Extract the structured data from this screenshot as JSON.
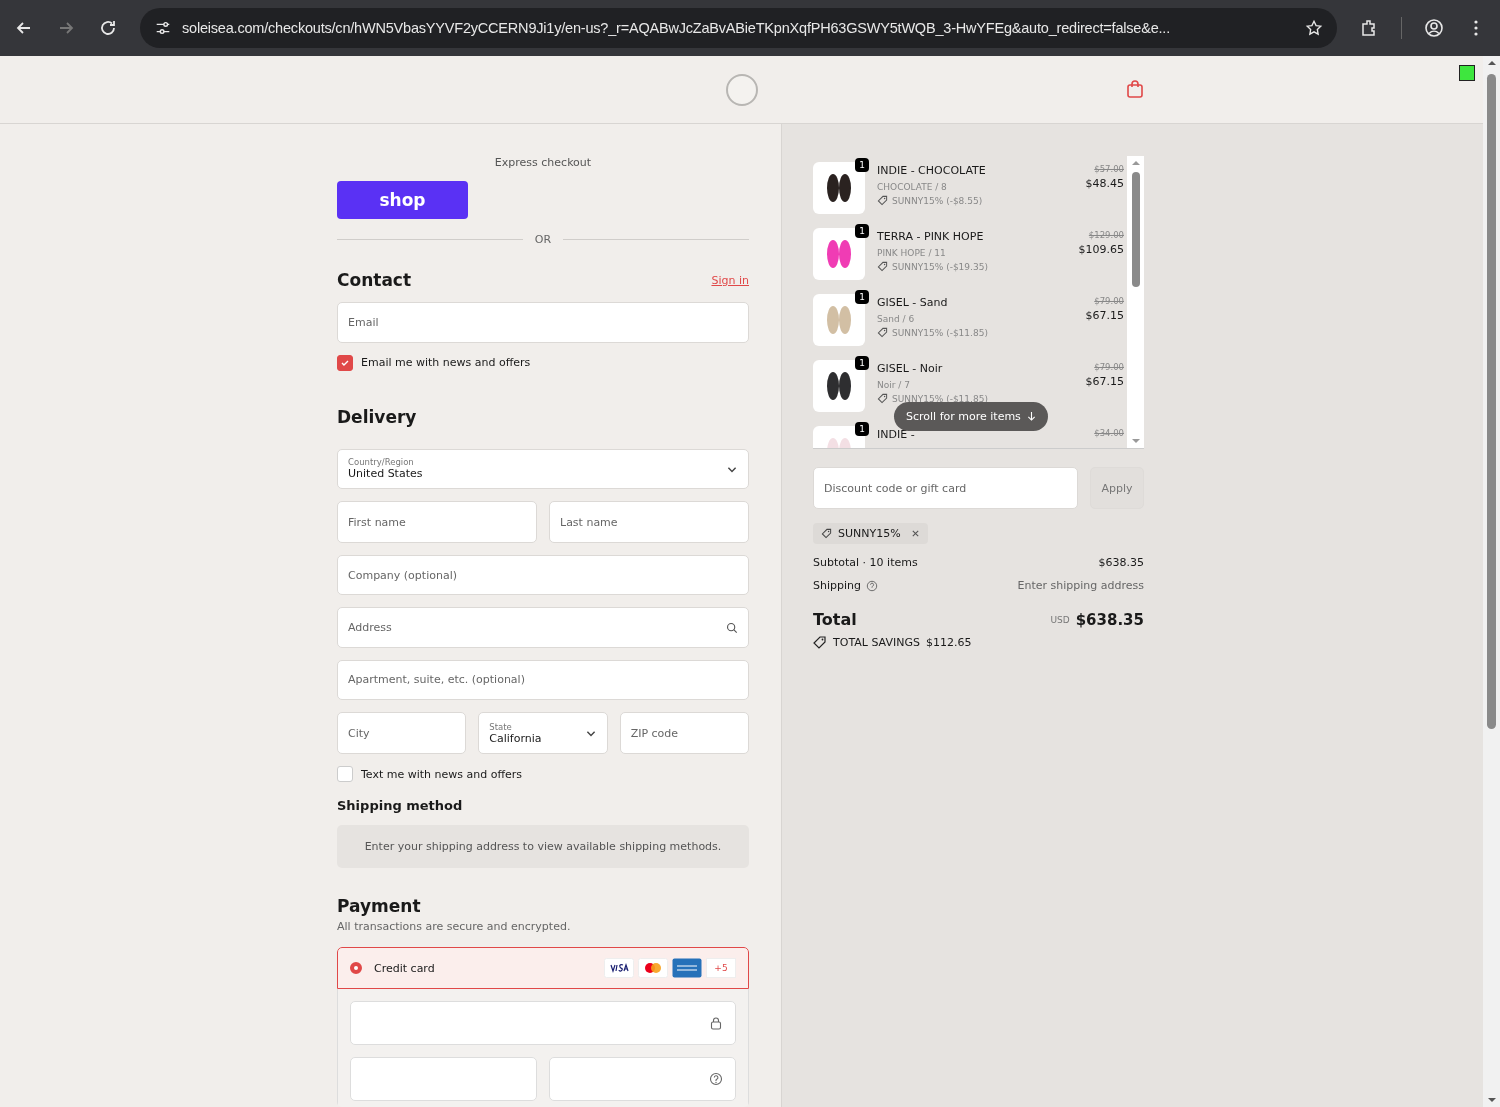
{
  "browser": {
    "url": "soleisea.com/checkouts/cn/hWN5VbasYYVF2yCCERN9Ji1y/en-us?_r=AQABwJcZaBvABieTKpnXqfPH63GSWY5tWQB_3-HwYFEg&auto_redirect=false&e..."
  },
  "express": {
    "title": "Express checkout",
    "shop_button": "shop",
    "divider": "OR"
  },
  "contact": {
    "heading": "Contact",
    "sign_in": "Sign in",
    "email_placeholder": "Email",
    "newsletter": {
      "label": "Email me with news and offers",
      "checked": true
    }
  },
  "delivery": {
    "heading": "Delivery",
    "country": {
      "label": "Country/Region",
      "value": "United States"
    },
    "first_name_placeholder": "First name",
    "last_name_placeholder": "Last name",
    "company_placeholder": "Company (optional)",
    "address_placeholder": "Address",
    "apartment_placeholder": "Apartment, suite, etc. (optional)",
    "city_placeholder": "City",
    "state": {
      "label": "State",
      "value": "California"
    },
    "zip_placeholder": "ZIP code",
    "sms": {
      "label": "Text me with news and offers",
      "checked": false
    }
  },
  "shipping_method": {
    "heading": "Shipping method",
    "notice": "Enter your shipping address to view available shipping methods."
  },
  "payment": {
    "heading": "Payment",
    "subtitle": "All transactions are secure and encrypted.",
    "methods": [
      {
        "label": "Credit card",
        "selected": true,
        "more": "+5"
      }
    ]
  },
  "cart": {
    "items": [
      {
        "name": "INDIE - CHOCOLATE",
        "variant": "CHOCOLATE / 8",
        "discount": "SUNNY15% (-$8.55)",
        "quantity": "1",
        "old_price": "$57.00",
        "price": "$48.45",
        "color": "#2a2220"
      },
      {
        "name": "TERRA - PINK HOPE",
        "variant": "PINK HOPE / 11",
        "discount": "SUNNY15% (-$19.35)",
        "quantity": "1",
        "old_price": "$129.00",
        "price": "$109.65",
        "color": "#f03cb4"
      },
      {
        "name": "GISEL - Sand",
        "variant": "Sand / 6",
        "discount": "SUNNY15% (-$11.85)",
        "quantity": "1",
        "old_price": "$79.00",
        "price": "$67.15",
        "color": "#d2bfa4"
      },
      {
        "name": "GISEL - Noir",
        "variant": "Noir / 7",
        "discount": "SUNNY15% (-$11.85)",
        "quantity": "1",
        "old_price": "$79.00",
        "price": "$67.15",
        "color": "#2e2e30"
      },
      {
        "name": "INDIE -",
        "quantity": "1",
        "old_price": "$34.00",
        "color": "#f3dfe4"
      }
    ],
    "scroll_hint": "Scroll for more items",
    "discount_placeholder": "Discount code or gift card",
    "apply": "Apply",
    "applied_code": "SUNNY15%",
    "subtotal_label": "Subtotal · 10 items",
    "subtotal": "$638.35",
    "shipping_label": "Shipping",
    "shipping_value": "Enter shipping address",
    "total_label": "Total",
    "currency": "USD",
    "total": "$638.35",
    "savings_label": "TOTAL SAVINGS",
    "savings": "$112.65"
  }
}
